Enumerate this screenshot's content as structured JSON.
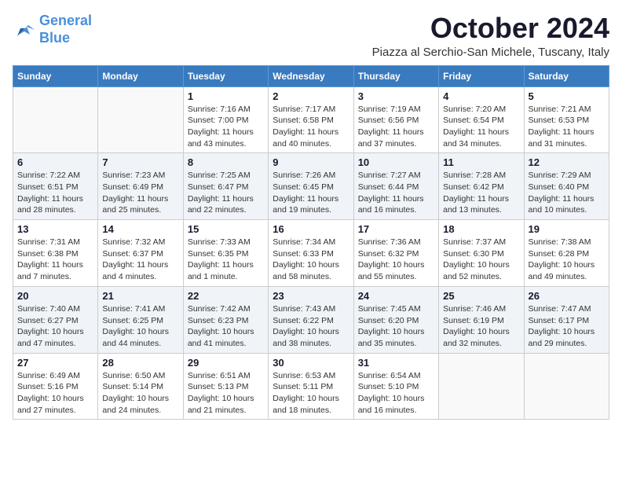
{
  "logo": {
    "line1": "General",
    "line2": "Blue"
  },
  "title": "October 2024",
  "location": "Piazza al Serchio-San Michele, Tuscany, Italy",
  "days_of_week": [
    "Sunday",
    "Monday",
    "Tuesday",
    "Wednesday",
    "Thursday",
    "Friday",
    "Saturday"
  ],
  "weeks": [
    [
      {
        "day": "",
        "info": ""
      },
      {
        "day": "",
        "info": ""
      },
      {
        "day": "1",
        "info": "Sunrise: 7:16 AM\nSunset: 7:00 PM\nDaylight: 11 hours and 43 minutes."
      },
      {
        "day": "2",
        "info": "Sunrise: 7:17 AM\nSunset: 6:58 PM\nDaylight: 11 hours and 40 minutes."
      },
      {
        "day": "3",
        "info": "Sunrise: 7:19 AM\nSunset: 6:56 PM\nDaylight: 11 hours and 37 minutes."
      },
      {
        "day": "4",
        "info": "Sunrise: 7:20 AM\nSunset: 6:54 PM\nDaylight: 11 hours and 34 minutes."
      },
      {
        "day": "5",
        "info": "Sunrise: 7:21 AM\nSunset: 6:53 PM\nDaylight: 11 hours and 31 minutes."
      }
    ],
    [
      {
        "day": "6",
        "info": "Sunrise: 7:22 AM\nSunset: 6:51 PM\nDaylight: 11 hours and 28 minutes."
      },
      {
        "day": "7",
        "info": "Sunrise: 7:23 AM\nSunset: 6:49 PM\nDaylight: 11 hours and 25 minutes."
      },
      {
        "day": "8",
        "info": "Sunrise: 7:25 AM\nSunset: 6:47 PM\nDaylight: 11 hours and 22 minutes."
      },
      {
        "day": "9",
        "info": "Sunrise: 7:26 AM\nSunset: 6:45 PM\nDaylight: 11 hours and 19 minutes."
      },
      {
        "day": "10",
        "info": "Sunrise: 7:27 AM\nSunset: 6:44 PM\nDaylight: 11 hours and 16 minutes."
      },
      {
        "day": "11",
        "info": "Sunrise: 7:28 AM\nSunset: 6:42 PM\nDaylight: 11 hours and 13 minutes."
      },
      {
        "day": "12",
        "info": "Sunrise: 7:29 AM\nSunset: 6:40 PM\nDaylight: 11 hours and 10 minutes."
      }
    ],
    [
      {
        "day": "13",
        "info": "Sunrise: 7:31 AM\nSunset: 6:38 PM\nDaylight: 11 hours and 7 minutes."
      },
      {
        "day": "14",
        "info": "Sunrise: 7:32 AM\nSunset: 6:37 PM\nDaylight: 11 hours and 4 minutes."
      },
      {
        "day": "15",
        "info": "Sunrise: 7:33 AM\nSunset: 6:35 PM\nDaylight: 11 hours and 1 minute."
      },
      {
        "day": "16",
        "info": "Sunrise: 7:34 AM\nSunset: 6:33 PM\nDaylight: 10 hours and 58 minutes."
      },
      {
        "day": "17",
        "info": "Sunrise: 7:36 AM\nSunset: 6:32 PM\nDaylight: 10 hours and 55 minutes."
      },
      {
        "day": "18",
        "info": "Sunrise: 7:37 AM\nSunset: 6:30 PM\nDaylight: 10 hours and 52 minutes."
      },
      {
        "day": "19",
        "info": "Sunrise: 7:38 AM\nSunset: 6:28 PM\nDaylight: 10 hours and 49 minutes."
      }
    ],
    [
      {
        "day": "20",
        "info": "Sunrise: 7:40 AM\nSunset: 6:27 PM\nDaylight: 10 hours and 47 minutes."
      },
      {
        "day": "21",
        "info": "Sunrise: 7:41 AM\nSunset: 6:25 PM\nDaylight: 10 hours and 44 minutes."
      },
      {
        "day": "22",
        "info": "Sunrise: 7:42 AM\nSunset: 6:23 PM\nDaylight: 10 hours and 41 minutes."
      },
      {
        "day": "23",
        "info": "Sunrise: 7:43 AM\nSunset: 6:22 PM\nDaylight: 10 hours and 38 minutes."
      },
      {
        "day": "24",
        "info": "Sunrise: 7:45 AM\nSunset: 6:20 PM\nDaylight: 10 hours and 35 minutes."
      },
      {
        "day": "25",
        "info": "Sunrise: 7:46 AM\nSunset: 6:19 PM\nDaylight: 10 hours and 32 minutes."
      },
      {
        "day": "26",
        "info": "Sunrise: 7:47 AM\nSunset: 6:17 PM\nDaylight: 10 hours and 29 minutes."
      }
    ],
    [
      {
        "day": "27",
        "info": "Sunrise: 6:49 AM\nSunset: 5:16 PM\nDaylight: 10 hours and 27 minutes."
      },
      {
        "day": "28",
        "info": "Sunrise: 6:50 AM\nSunset: 5:14 PM\nDaylight: 10 hours and 24 minutes."
      },
      {
        "day": "29",
        "info": "Sunrise: 6:51 AM\nSunset: 5:13 PM\nDaylight: 10 hours and 21 minutes."
      },
      {
        "day": "30",
        "info": "Sunrise: 6:53 AM\nSunset: 5:11 PM\nDaylight: 10 hours and 18 minutes."
      },
      {
        "day": "31",
        "info": "Sunrise: 6:54 AM\nSunset: 5:10 PM\nDaylight: 10 hours and 16 minutes."
      },
      {
        "day": "",
        "info": ""
      },
      {
        "day": "",
        "info": ""
      }
    ]
  ]
}
